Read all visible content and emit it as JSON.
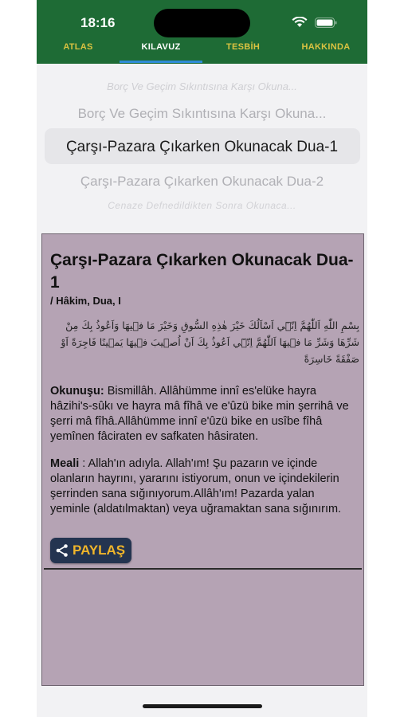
{
  "status_bar": {
    "time": "18:16"
  },
  "tabs": [
    {
      "label": "ATLAS",
      "active": false
    },
    {
      "label": "KILAVUZ",
      "active": true
    },
    {
      "label": "TESBİH",
      "active": false
    },
    {
      "label": "HAKKINDA",
      "active": false
    }
  ],
  "picker": {
    "items": [
      "Borç Ve Geçim Sıkıntısına Karşı Okuna...",
      "Borç Ve Geçim Sıkıntısına Karşı Okuna...",
      "Çarşı-Pazara Çıkarken Okunacak Dua-1",
      "Çarşı-Pazara Çıkarken Okunacak Dua-2",
      "Cenaze Defnedildikten Sonra Okunaca..."
    ],
    "selected": "Çarşı-Pazara Çıkarken Okunacak Dua-1"
  },
  "dua": {
    "title": "Çarşı-Pazara Çıkarken Okunacak Dua-1",
    "source": "/ Hâkim, Dua, I",
    "arabic": "بِسْمِ اللّٰهِ اَللّٰهُمَّ اِنّٖٓي اَسْاَلُكَ خَيْرَ هٰذِهِ السُّوقِ وَخَيْرَ مَا فٖيهَا وَاَعُوذُ بِكَ مِنْ شَرِّهَا وَشَرِّ مَا فٖيهَا اَللّٰهُمَّ اِنّٖٓي اَعُوذُ بِكَ اَنْ اُصٖيبَ فٖيهَا يَمٖينًا فَاجِرَةً اَوْ صَفْقَةً خَاسِرَةً",
    "okunusu_label": "Okunuşu:",
    "okunusu_text": " Bismillâh. Allâhümme innî es'elüke hayra hâzihi's-sûkı ve hayra mâ fîhâ ve e'ûzü bike min şerrihâ ve şerri mâ fîhâ.Allâhümme innî e'ûzü bike en usîbe fîhâ yemînen fâciraten ev safkaten hâsiraten.",
    "meali_label": "Meali",
    "meali_text": "       : Allah'ın adıyla. Allah'ım! Şu pazarın ve içinde olanların hayrını, yararını istiyorum, onun ve içindekilerin şerrinden sana sığınıyorum.Allâh'ım! Pazarda yalan yeminle (aldatılmaktan) veya uğramaktan sana sığınırım."
  },
  "share": {
    "label": "PAYLAŞ",
    "icon": "share-icon"
  },
  "colors": {
    "topbar": "#1e6b35",
    "tab_inactive": "#d9c241",
    "tab_active": "#ffffff",
    "tab_indicator": "#2e8bd6",
    "card": "#b5a3b4",
    "share_bg": "#243450",
    "share_text": "#f0b52a"
  }
}
